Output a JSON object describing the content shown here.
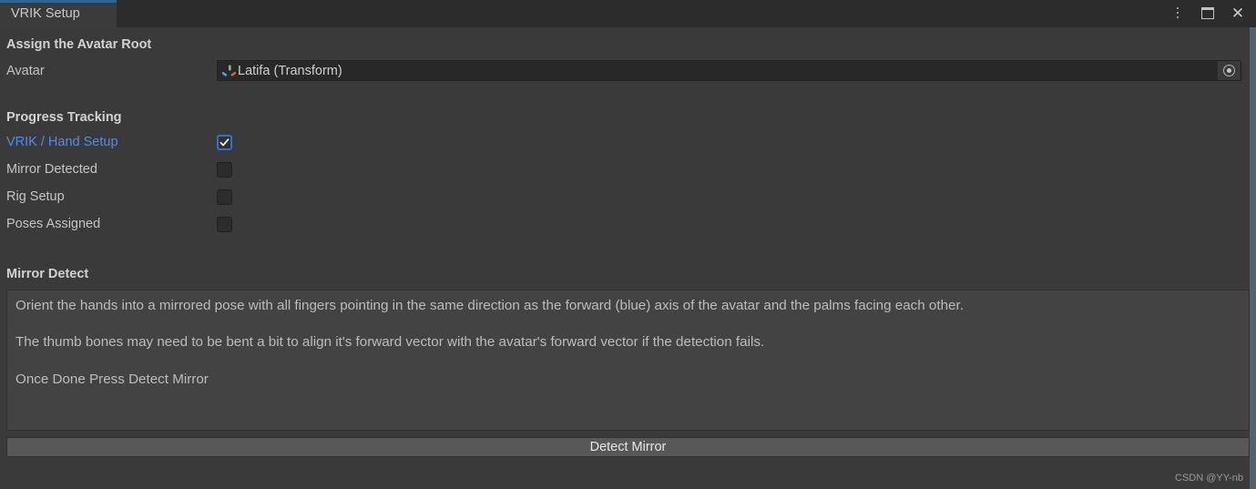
{
  "window": {
    "tab_label": "VRIK Setup",
    "controls": {
      "menu_icon": "vertical-dots-icon",
      "maximize_icon": "maximize-icon",
      "close_icon": "close-icon"
    }
  },
  "sections": {
    "assign_root": {
      "heading": "Assign the Avatar Root",
      "avatar": {
        "label": "Avatar",
        "value": "Latifa (Transform)",
        "icon": "transform-icon",
        "picker_icon": "object-picker-icon"
      }
    },
    "progress": {
      "heading": "Progress Tracking",
      "items": [
        {
          "label": "VRIK / Hand Setup",
          "checked": true
        },
        {
          "label": "Mirror Detected",
          "checked": false
        },
        {
          "label": "Rig Setup",
          "checked": false
        },
        {
          "label": "Poses Assigned",
          "checked": false
        }
      ]
    },
    "mirror_detect": {
      "heading": "Mirror Detect",
      "help_paragraphs": [
        "Orient the hands into a mirrored pose with all fingers pointing in the same direction as the forward (blue) axis of the avatar and the palms facing each other.",
        "The thumb bones may need to be bent a bit to align it's forward vector with the avatar's forward vector if the detection fails.",
        "Once Done Press Detect Mirror"
      ],
      "button_label": "Detect Mirror"
    }
  },
  "watermark": "CSDN @YY-nb",
  "colors": {
    "tab_accent": "#2f6494",
    "active_label": "#4c8ef0",
    "checkbox_checked_border": "#2f72c9",
    "window_background": "#3a3a3a",
    "tabbar_background": "#2c2c2c",
    "field_background": "#282828",
    "helpbox_background": "#434343",
    "button_background": "#585858",
    "edge_strip": "#53636e"
  }
}
